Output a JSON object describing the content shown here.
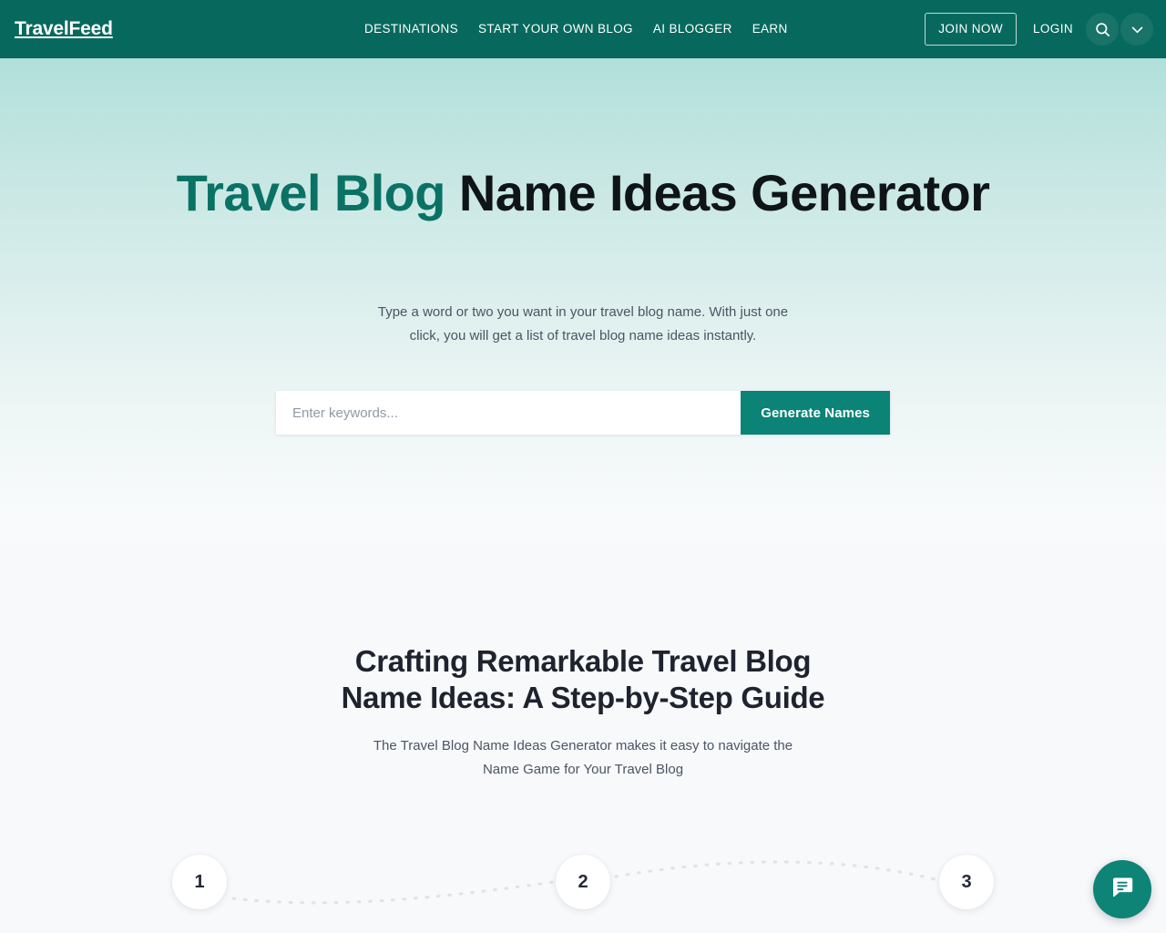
{
  "header": {
    "logo": "TravelFeed",
    "nav_links": [
      {
        "label": "DESTINATIONS"
      },
      {
        "label": "START YOUR OWN BLOG"
      },
      {
        "label": "AI BLOGGER"
      },
      {
        "label": "EARN"
      }
    ],
    "join_label": "JOIN NOW",
    "login_label": "LOGIN",
    "search_icon": "search-icon",
    "chevron_icon": "chevron-down-icon",
    "background_color": "#07695e"
  },
  "hero": {
    "title_accent": "Travel Blog",
    "title_rest": " Name Ideas Generator",
    "subtitle_line1": "Type a word or two you want in your travel blog name. With just one",
    "subtitle_line2": "click, you will get a list of travel blog name ideas instantly.",
    "accent_color": "#0a7265",
    "search": {
      "placeholder": "Enter keywords...",
      "value": "",
      "button_label": "Generate Names",
      "button_color": "#0b8376"
    }
  },
  "steps_section": {
    "title_line1": "Crafting Remarkable Travel Blog",
    "title_line2": "Name Ideas: A Step-by-Step Guide",
    "subtitle_line1": "The Travel Blog Name Ideas Generator makes it easy to navigate the",
    "subtitle_line2": "Name Game for Your Travel Blog",
    "steps": [
      {
        "number": "1"
      },
      {
        "number": "2"
      },
      {
        "number": "3"
      }
    ]
  },
  "chat_widget": {
    "icon": "chat-bubble-icon",
    "color": "#0e8477"
  }
}
